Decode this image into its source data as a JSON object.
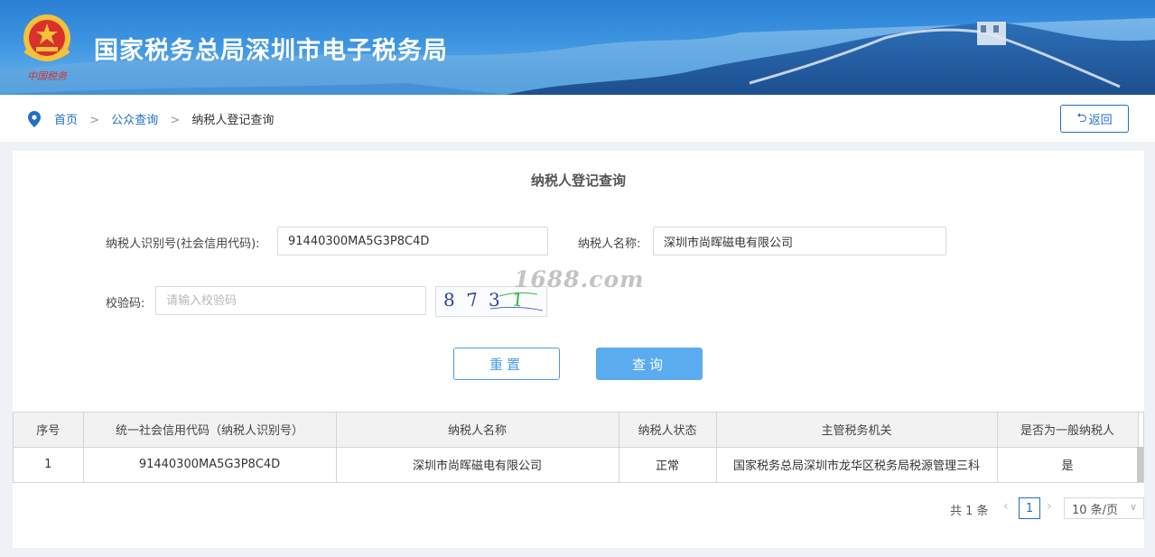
{
  "header": {
    "title": "国家税务总局深圳市电子税务局",
    "emblem_text": "中国税务"
  },
  "breadcrumb": {
    "home": "首页",
    "public_query": "公众查询",
    "current": "纳税人登记查询",
    "separator": ">"
  },
  "back_button": {
    "label": "返回",
    "icon": "undo-arrow-icon"
  },
  "form": {
    "title": "纳税人登记查询",
    "taxpayer_id_label": "纳税人识别号(社会信用代码):",
    "taxpayer_id_value": "91440300MA5G3P8C4D",
    "taxpayer_name_label": "纳税人名称:",
    "taxpayer_name_value": "深圳市尚晖磁电有限公司",
    "captcha_label": "校验码:",
    "captcha_placeholder": "请输入校验码",
    "captcha_chars": [
      "8",
      "7",
      "3",
      "1"
    ],
    "watermark": "1688.com",
    "reset_label": "重置",
    "query_label": "查询"
  },
  "table": {
    "headers": [
      "序号",
      "统一社会信用代码（纳税人识别号）",
      "纳税人名称",
      "纳税人状态",
      "主管税务机关",
      "是否为一般纳税人"
    ],
    "rows": [
      [
        "1",
        "91440300MA5G3P8C4D",
        "深圳市尚晖磁电有限公司",
        "正常",
        "国家税务总局深圳市龙华区税务局税源管理三科",
        "是"
      ]
    ]
  },
  "pager": {
    "total": "共 1 条",
    "current_page": "1",
    "page_size": "10 条/页"
  },
  "colors": {
    "primary": "#1f6fc5",
    "query_button": "#5aacef",
    "banner": "#2a7fd4"
  }
}
